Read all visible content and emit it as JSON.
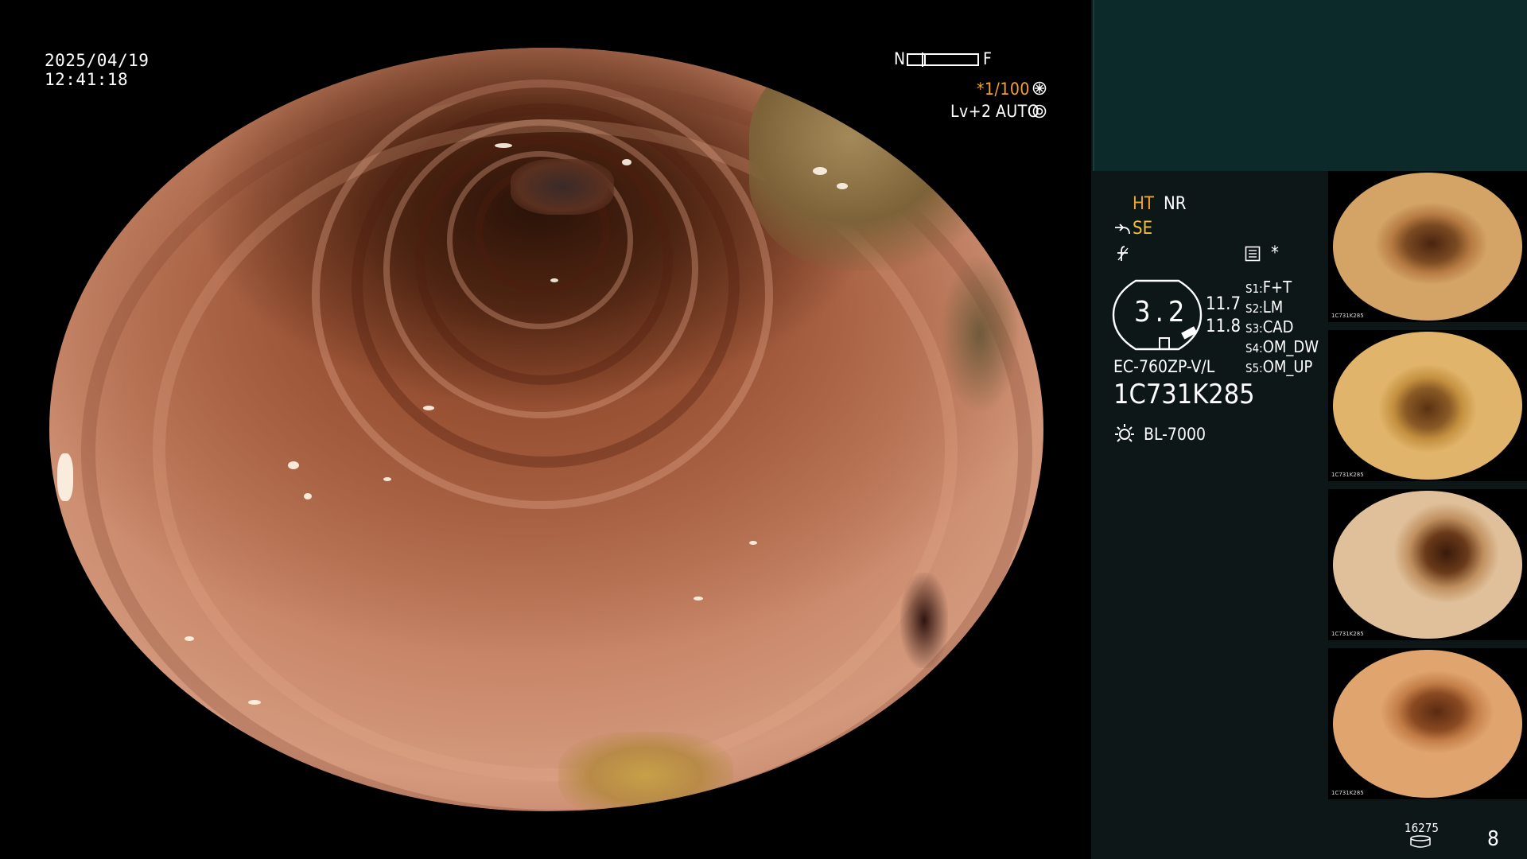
{
  "header": {
    "date": "2025/04/19",
    "time": "12:41:18"
  },
  "scale": {
    "near_label": "N",
    "far_label": "F"
  },
  "exposure": {
    "shutter": "*1/100",
    "level": "Lv+2",
    "mode": "AUTO"
  },
  "modes": {
    "ht": "HT",
    "nr": "NR",
    "se": "SE",
    "star": "*"
  },
  "gauge": {
    "value": "3.2",
    "upper": "11.7",
    "lower": "11.8"
  },
  "presets": [
    {
      "key": "S1:",
      "value": "F+T"
    },
    {
      "key": "S2:",
      "value": "LM"
    },
    {
      "key": "S3:",
      "value": "CAD"
    },
    {
      "key": "S4:",
      "value": "OM_DW"
    },
    {
      "key": "S5:",
      "value": "OM_UP"
    }
  ],
  "scope": {
    "model": "EC-760ZP-V/L",
    "serial": "1C731K285",
    "light_source": "BL-7000"
  },
  "storage": {
    "remaining": "16275",
    "count": "8"
  },
  "thumbnails": [
    {
      "serial": "1C731K285"
    },
    {
      "serial": "1C731K285"
    },
    {
      "serial": "1C731K285"
    },
    {
      "serial": "1C731K285"
    }
  ],
  "colors": {
    "panel_bg": "#0d1718",
    "panel_teal": "#0c2a2a",
    "accent_orange": "#f3a32a",
    "accent_yellow": "#f1c232"
  },
  "icons": [
    "sun-icon",
    "shutter-gear-icon",
    "auto-iris-icon",
    "menu-doc-icon",
    "disk-icon",
    "se-hook-icon",
    "sharpness-icon"
  ]
}
